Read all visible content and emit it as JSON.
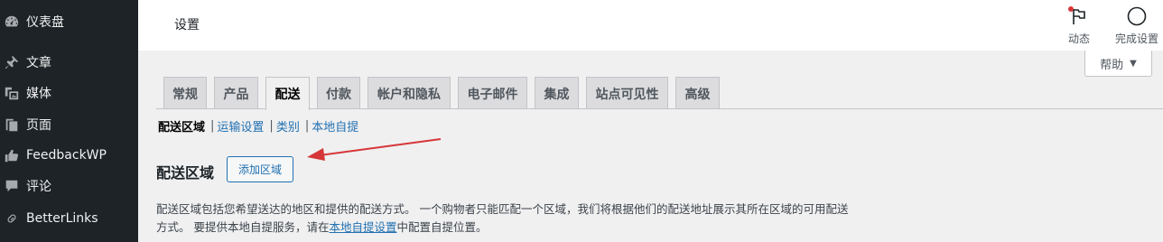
{
  "sidebar": {
    "items": [
      {
        "label": "仪表盘",
        "icon": "dashboard-icon"
      },
      {
        "label": "文章",
        "icon": "pin-icon"
      },
      {
        "label": "媒体",
        "icon": "media-icon"
      },
      {
        "label": "页面",
        "icon": "page-icon"
      },
      {
        "label": "FeedbackWP",
        "icon": "thumbs-up-icon"
      },
      {
        "label": "评论",
        "icon": "comment-icon"
      },
      {
        "label": "BetterLinks",
        "icon": "link-icon"
      }
    ]
  },
  "header": {
    "title": "设置",
    "activity_label": "动态",
    "finish_label": "完成设置"
  },
  "help": {
    "label": "帮助",
    "caret": "▼"
  },
  "tabs": [
    {
      "label": "常规",
      "active": false
    },
    {
      "label": "产品",
      "active": false
    },
    {
      "label": "配送",
      "active": true
    },
    {
      "label": "付款",
      "active": false
    },
    {
      "label": "帐户和隐私",
      "active": false
    },
    {
      "label": "电子邮件",
      "active": false
    },
    {
      "label": "集成",
      "active": false
    },
    {
      "label": "站点可见性",
      "active": false
    },
    {
      "label": "高级",
      "active": false
    }
  ],
  "subnav": {
    "current": "配送区域",
    "links": [
      "运输设置",
      "类别",
      "本地自提"
    ],
    "separator": "|"
  },
  "section": {
    "heading": "配送区域",
    "add_button": "添加区域"
  },
  "description": {
    "line1": "配送区域包括您希望送达的地区和提供的配送方式。 一个购物者只能匹配一个区域，我们将根据他们的配送地址展示其所在区域的可用配送",
    "line2_before": "方式。 要提供本地自提服务，请在",
    "line2_link": "本地自提设置",
    "line2_after": "中配置自提位置。"
  },
  "colors": {
    "sidebar_bg": "#1d2327",
    "accent": "#2271b1",
    "arrow": "#d63638"
  }
}
